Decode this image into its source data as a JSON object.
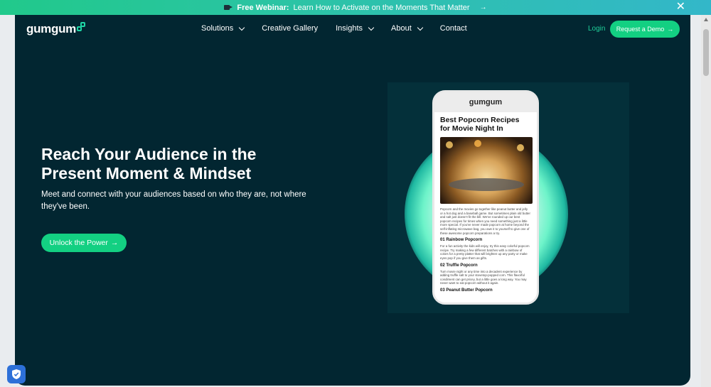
{
  "announcement": {
    "bold": "Free Webinar:",
    "text": "Learn How to Activate on the Moments That Matter",
    "arrow": "→",
    "close": "✕"
  },
  "nav": {
    "logo": "gumgum",
    "items": [
      {
        "label": "Solutions",
        "dropdown": true
      },
      {
        "label": "Creative Gallery",
        "dropdown": false
      },
      {
        "label": "Insights",
        "dropdown": true
      },
      {
        "label": "About",
        "dropdown": true
      },
      {
        "label": "Contact",
        "dropdown": false
      }
    ],
    "login": "Login",
    "demo": "Request a Demo",
    "demo_arrow": "→"
  },
  "hero": {
    "title": "Reach Your Audience in the Present Moment & Mindset",
    "subtitle": "Meet and connect with your audiences based on who they are, not where they've been.",
    "cta": "Unlock the Power",
    "cta_arrow": "→"
  },
  "phone": {
    "logo": "gumgum",
    "title": "Best Popcorn Recipes for Movie Night In",
    "intro": "Popcorn and the movies go together like peanut butter and jelly or a hot dog and a baseball game. But sometimes plain old butter and salt just doesn't fit the bill. We've rounded up our best popcorn recipes for times when you need something just a little more special. If you've never made popcorn at home beyond the self-inflating microwave bag, you owe it to yourself to give one of these awesome popcorn preparations a try.",
    "h1": "01 Rainbow Popcorn",
    "p1": "For a fun activity the kids will enjoy, try this easy colorful popcorn recipe. Try making a few different batches with a rainbow of colors for a pretty platter that will brighten up any party or make eyes pop if you give them as gifts.",
    "h2": "02 Truffle Popcorn",
    "p2": "Turn movie night or any time into a decadent experience by adding truffle salt to your stovetop-popped corn. This flavorful condiment can get pricey, but a little goes a long way. You may never want to eat popcorn without it again.",
    "h3": "03 Peanut Butter Popcorn"
  },
  "colors": {
    "page_bg": "#022631",
    "accent": "#13d082",
    "login": "#1fd19a"
  }
}
